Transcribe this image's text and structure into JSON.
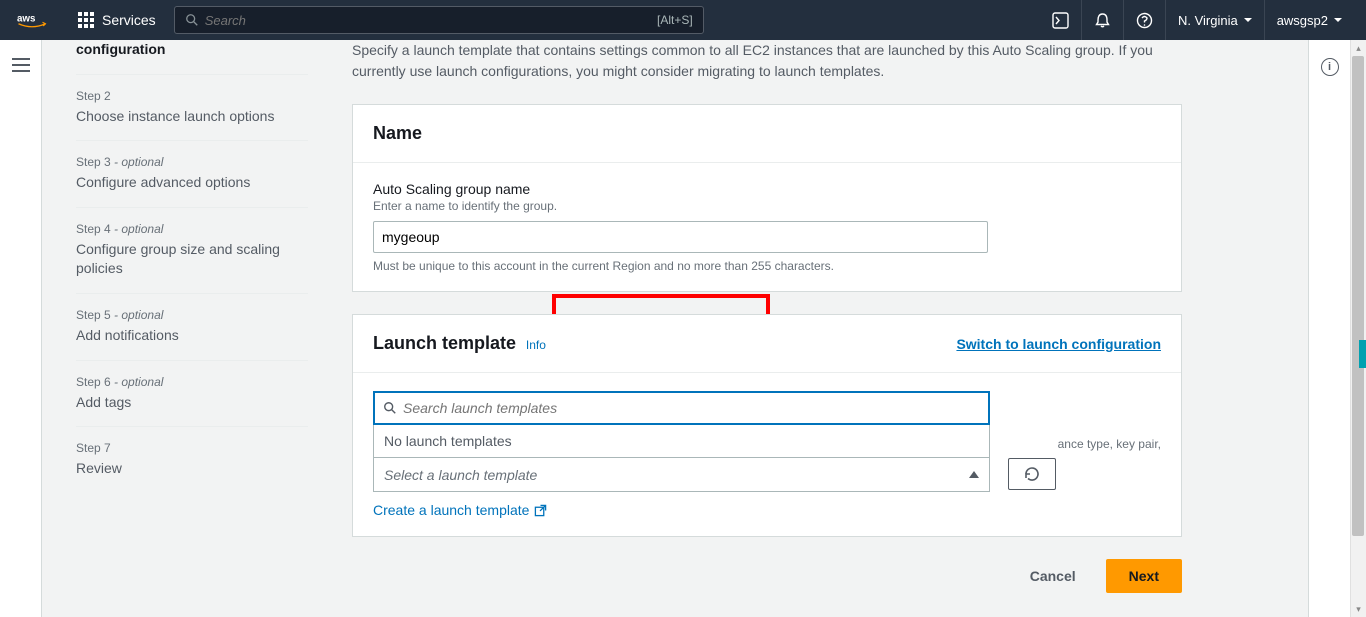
{
  "topbar": {
    "services": "Services",
    "search_placeholder": "Search",
    "search_shortcut": "[Alt+S]",
    "region": "N. Virginia",
    "account": "awsgsp2"
  },
  "sidebar": {
    "steps": [
      {
        "tag": "",
        "optional": "",
        "title": "configuration",
        "active": true
      },
      {
        "tag": "Step 2",
        "optional": "",
        "title": "Choose instance launch options"
      },
      {
        "tag": "Step 3",
        "optional": " - optional",
        "title": "Configure advanced options"
      },
      {
        "tag": "Step 4",
        "optional": " - optional",
        "title": "Configure group size and scaling policies"
      },
      {
        "tag": "Step 5",
        "optional": " - optional",
        "title": "Add notifications"
      },
      {
        "tag": "Step 6",
        "optional": " - optional",
        "title": "Add tags"
      },
      {
        "tag": "Step 7",
        "optional": "",
        "title": "Review"
      }
    ]
  },
  "main": {
    "intro": "Specify a launch template that contains settings common to all EC2 instances that are launched by this Auto Scaling group. If you currently use launch configurations, you might consider migrating to launch templates.",
    "name_panel": {
      "heading": "Name",
      "label": "Auto Scaling group name",
      "desc": "Enter a name to identify the group.",
      "value": "mygeoup",
      "hint": "Must be unique to this account in the current Region and no more than 255 characters."
    },
    "template_panel": {
      "heading": "Launch template",
      "info": "Info",
      "switch": "Switch to launch configuration",
      "search_placeholder": "Search launch templates",
      "empty": "No launch templates",
      "select_placeholder": "Select a launch template",
      "side_hint": "ance type, key pair,",
      "create_link": "Create a launch template"
    },
    "actions": {
      "cancel": "Cancel",
      "next": "Next"
    }
  }
}
